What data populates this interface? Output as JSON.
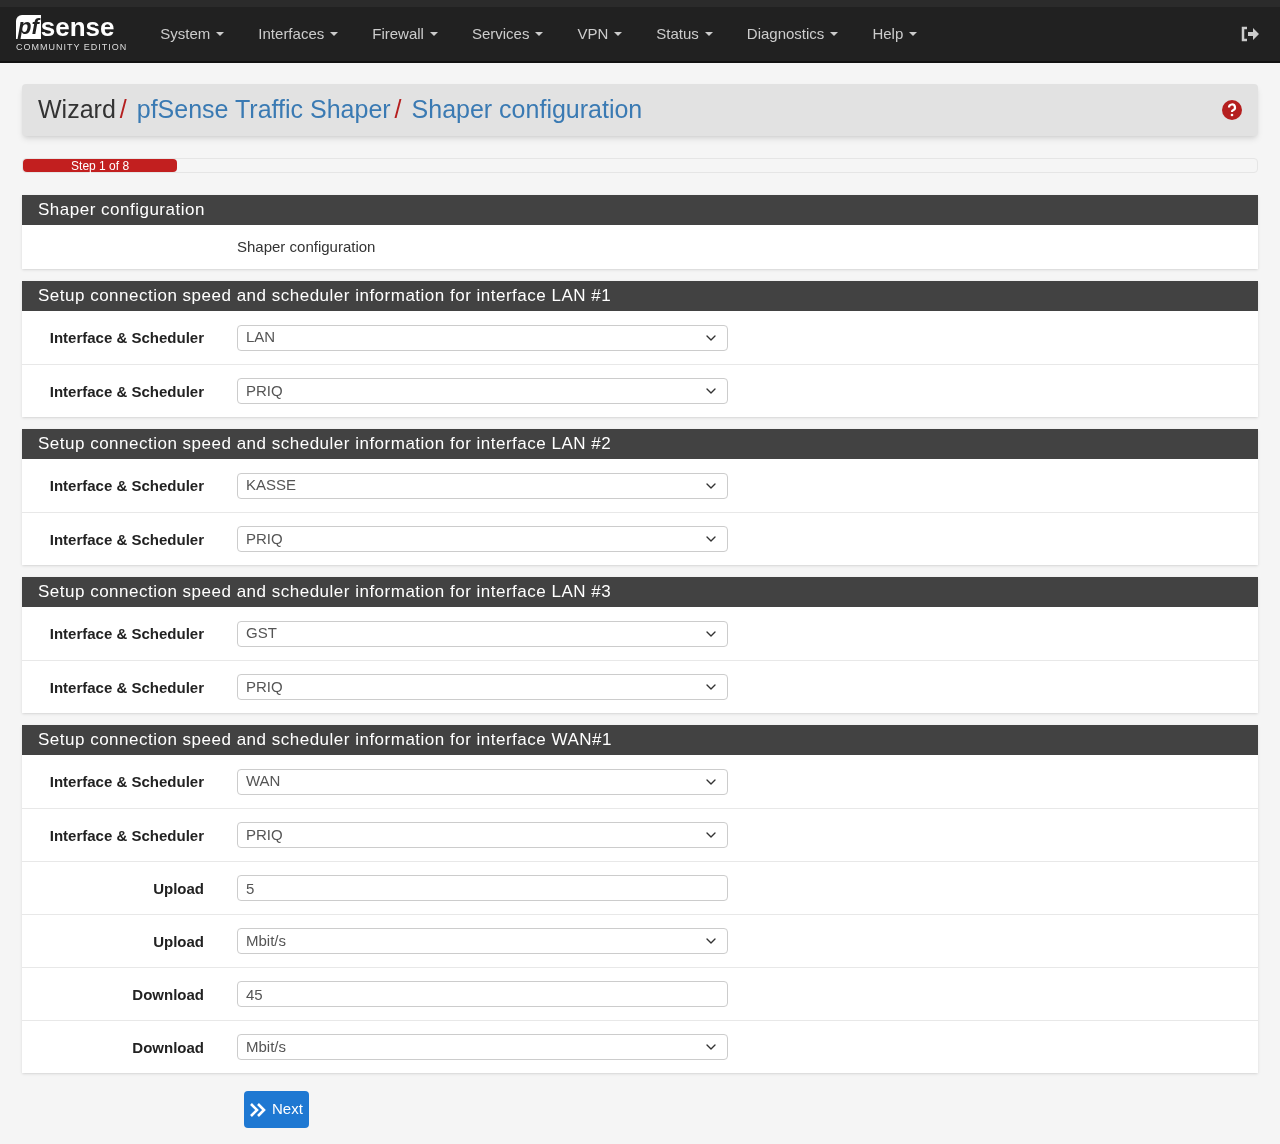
{
  "navbar": {
    "logo": {
      "mark": "pf",
      "word": "sense",
      "edition": "COMMUNITY EDITION"
    },
    "menu": [
      "System",
      "Interfaces",
      "Firewall",
      "Services",
      "VPN",
      "Status",
      "Diagnostics",
      "Help"
    ]
  },
  "breadcrumb": [
    {
      "label": "Wizard",
      "link": false
    },
    {
      "separator": "/",
      "label": "pfSense Traffic Shaper",
      "link": true
    },
    {
      "separator": "/",
      "label": "Shaper configuration",
      "link": true
    }
  ],
  "progress": {
    "label": "Step 1 of 8",
    "level": 0.125
  },
  "intro": {
    "title": "Shaper configuration",
    "text": "Shaper configuration"
  },
  "sections": [
    {
      "title": "Setup connection speed and scheduler information for interface LAN #1",
      "fields": [
        {
          "label": "Interface & Scheduler",
          "kind": "select",
          "value": "LAN"
        },
        {
          "label": "Interface & Scheduler",
          "kind": "select",
          "value": "PRIQ"
        }
      ]
    },
    {
      "title": "Setup connection speed and scheduler information for interface LAN #2",
      "fields": [
        {
          "label": "Interface & Scheduler",
          "kind": "select",
          "value": "KASSE"
        },
        {
          "label": "Interface & Scheduler",
          "kind": "select",
          "value": "PRIQ"
        }
      ]
    },
    {
      "title": "Setup connection speed and scheduler information for interface LAN #3",
      "fields": [
        {
          "label": "Interface & Scheduler",
          "kind": "select",
          "value": "GST"
        },
        {
          "label": "Interface & Scheduler",
          "kind": "select",
          "value": "PRIQ"
        }
      ]
    },
    {
      "title": "Setup connection speed and scheduler information for interface WAN#1",
      "fields": [
        {
          "label": "Interface & Scheduler",
          "kind": "select",
          "value": "WAN"
        },
        {
          "label": "Interface & Scheduler",
          "kind": "select",
          "value": "PRIQ"
        },
        {
          "label": "Upload",
          "kind": "input",
          "value": "5"
        },
        {
          "label": "Upload",
          "kind": "select",
          "value": "Mbit/s"
        },
        {
          "label": "Download",
          "kind": "input",
          "value": "45"
        },
        {
          "label": "Download",
          "kind": "select",
          "value": "Mbit/s"
        }
      ]
    }
  ],
  "next_button": "Next"
}
